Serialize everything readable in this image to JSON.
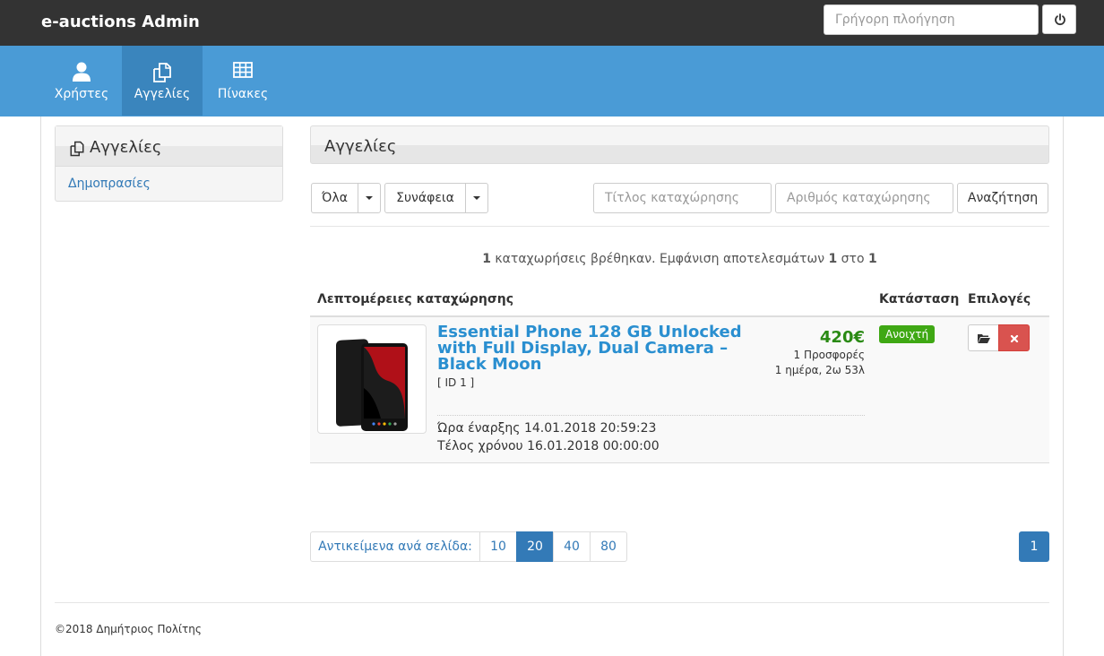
{
  "app": {
    "brand": "e-auctions Admin"
  },
  "topbar": {
    "search_placeholder": "Γρήγορη πλοήγηση",
    "power_icon": "power-icon"
  },
  "nav": {
    "tabs": [
      {
        "label": "Χρήστες",
        "icon": "user-icon",
        "active": false
      },
      {
        "label": "Αγγελίες",
        "icon": "copy-icon",
        "active": true
      },
      {
        "label": "Πίνακες",
        "icon": "table-icon",
        "active": false
      }
    ]
  },
  "sidebar": {
    "title": "Αγγελίες",
    "icon": "copy-icon",
    "items": [
      {
        "label": "Δημοπρασίες"
      }
    ]
  },
  "main": {
    "title": "Αγγελίες",
    "filters": {
      "status_label": "Όλα",
      "sort_label": "Συνάφεια",
      "title_placeholder": "Τίτλος καταχώρησης",
      "number_placeholder": "Αριθμός καταχώρησης",
      "search_button": "Αναζήτηση"
    },
    "results": {
      "count": "1",
      "text1": " καταχωρήσεις βρέθηκαν. Εμφάνιση αποτελεσμάτων ",
      "from": "1",
      "text2": " στο ",
      "to": "1"
    },
    "table": {
      "headers": {
        "details": "Λεπτομέρειες καταχώρησης",
        "status": "Κατάσταση",
        "options": "Επιλογές"
      },
      "rows": [
        {
          "title": "Essential Phone 128 GB Unlocked with Full Display, Dual Camera – Black Moon",
          "id": "[ ID 1 ]",
          "price": "420€",
          "bids": "1 Προσφορές",
          "time_left": "1 ημέρα, 2ω 53λ",
          "start": "Ώρα έναρξης 14.01.2018 20:59:23",
          "end": "Τέλος χρόνου 16.01.2018 00:00:00",
          "status": "Ανοιχτή",
          "status_color": "#3fa814"
        }
      ]
    },
    "pagination": {
      "per_page_label": "Αντικείμενα ανά σελίδα:",
      "sizes": [
        "10",
        "20",
        "40",
        "80"
      ],
      "active_size": "20",
      "pages": [
        "1"
      ],
      "current_page": "1"
    }
  },
  "footer": {
    "text": "©2018 Δημήτριος Πολίτης"
  },
  "colors": {
    "topbar": "#333333",
    "navbar": "#4a9bd6",
    "nav_active": "#3a85bd",
    "link": "#337ab7",
    "price": "#2a8a14",
    "danger": "#d9534f"
  }
}
